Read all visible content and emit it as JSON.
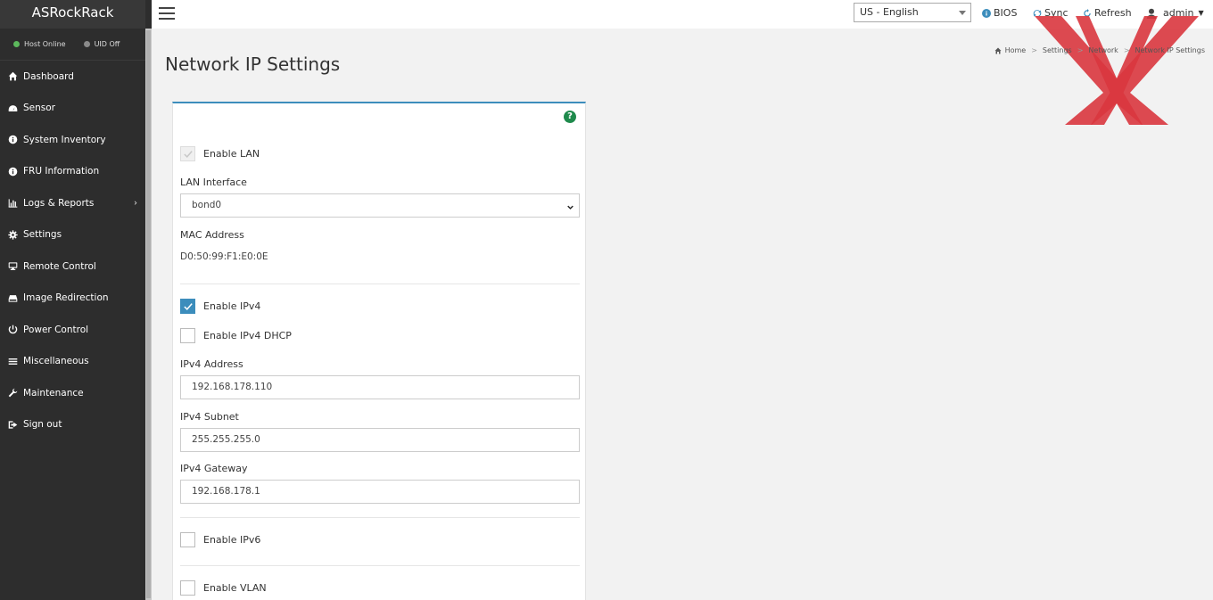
{
  "sidebar": {
    "brand": "ASRockRack",
    "status": [
      {
        "label": "Host Online",
        "color": "#5cb85c"
      },
      {
        "label": "UID Off",
        "color": "#8a8a8a"
      }
    ],
    "items": [
      {
        "label": "Dashboard",
        "icon": "home-icon"
      },
      {
        "label": "Sensor",
        "icon": "gauge-icon"
      },
      {
        "label": "System Inventory",
        "icon": "info-icon"
      },
      {
        "label": "FRU Information",
        "icon": "info-icon"
      },
      {
        "label": "Logs & Reports",
        "icon": "bar-chart-icon",
        "has_submenu": true
      },
      {
        "label": "Settings",
        "icon": "gear-icon"
      },
      {
        "label": "Remote Control",
        "icon": "monitor-icon"
      },
      {
        "label": "Image Redirection",
        "icon": "drive-icon"
      },
      {
        "label": "Power Control",
        "icon": "power-icon"
      },
      {
        "label": "Miscellaneous",
        "icon": "list-icon"
      },
      {
        "label": "Maintenance",
        "icon": "wrench-icon"
      },
      {
        "label": "Sign out",
        "icon": "sign-out-icon"
      }
    ]
  },
  "topbar": {
    "language": "US - English",
    "bios_label": "BIOS",
    "sync_label": "Sync",
    "refresh_label": "Refresh",
    "user_label": "admin"
  },
  "page": {
    "title": "Network IP Settings",
    "breadcrumb": [
      "Home",
      "Settings",
      "Network",
      "Network IP Settings"
    ]
  },
  "form": {
    "enable_lan": {
      "label": "Enable LAN",
      "checked": true,
      "disabled": true
    },
    "lan_interface": {
      "label": "LAN Interface",
      "value": "bond0"
    },
    "mac_address": {
      "label": "MAC Address",
      "value": "D0:50:99:F1:E0:0E"
    },
    "enable_ipv4": {
      "label": "Enable IPv4",
      "checked": true
    },
    "enable_ipv4_dhcp": {
      "label": "Enable IPv4 DHCP",
      "checked": false
    },
    "ipv4_address": {
      "label": "IPv4 Address",
      "value": "192.168.178.110"
    },
    "ipv4_subnet": {
      "label": "IPv4 Subnet",
      "value": "255.255.255.0"
    },
    "ipv4_gateway": {
      "label": "IPv4 Gateway",
      "value": "192.168.178.1"
    },
    "enable_ipv6": {
      "label": "Enable IPv6",
      "checked": false
    },
    "enable_vlan": {
      "label": "Enable VLAN",
      "checked": false
    }
  },
  "colors": {
    "sidebar_bg": "#2d2d2d",
    "accent": "#3c8dbc",
    "help_green": "#1f8a4c",
    "watermark_red": "#d9363e"
  }
}
